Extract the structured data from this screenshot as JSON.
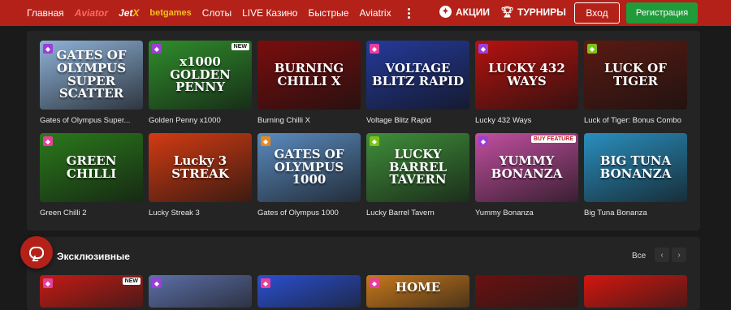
{
  "header": {
    "nav": [
      "Главная",
      "Aviator",
      "Jet",
      "X",
      "betgames",
      "Слоты",
      "LIVE Казино",
      "Быстрые",
      "Aviatrix"
    ],
    "promo_label": "АКЦИИ",
    "tournaments_label": "ТУРНИРЫ",
    "login_label": "Вход",
    "register_label": "Регистрация"
  },
  "games": [
    {
      "name": "Gates of Olympus Super...",
      "art": "GATES OF OLYMPUS SUPER SCATTER",
      "bg": "#8fb3d9"
    },
    {
      "name": "Golden Penny x1000",
      "art": "x1000 GOLDEN PENNY",
      "bg": "#2f8e2c",
      "tag": "NEW"
    },
    {
      "name": "Burning Chilli X",
      "art": "BURNING CHILLI X",
      "bg": "#7a0d0d"
    },
    {
      "name": "Voltage Blitz Rapid",
      "art": "VOLTAGE BLITZ RAPID",
      "bg": "#243a9a"
    },
    {
      "name": "Lucky 432 Ways",
      "art": "LUCKY 432 WAYS",
      "bg": "#b5120f"
    },
    {
      "name": "Luck of Tiger: Bonus Combo",
      "art": "LUCK OF TIGER",
      "bg": "#5a1a12"
    },
    {
      "name": "Green Chilli 2",
      "art": "GREEN CHILLI",
      "bg": "#2a7a1b"
    },
    {
      "name": "Lucky Streak 3",
      "art": "Lucky 3 STREAK",
      "bg": "#d23b12"
    },
    {
      "name": "Gates of Olympus 1000",
      "art": "GATES OF OLYMPUS 1000",
      "bg": "#5b8bbf"
    },
    {
      "name": "Lucky Barrel Tavern",
      "art": "LUCKY BARREL TAVERN",
      "bg": "#3f8f3a"
    },
    {
      "name": "Yummy Bonanza",
      "art": "YUMMY BONANZA",
      "bg": "#c24fa0",
      "tag": "BUY FEATURE"
    },
    {
      "name": "Big Tuna Bonanza",
      "art": "BIG TUNA BONANZA",
      "bg": "#2a8fbf"
    }
  ],
  "exclusive": {
    "title": "Эксклюзивные",
    "all_label": "Все",
    "prev_icon": "‹",
    "next_icon": "›",
    "tiles": [
      {
        "bg": "#c51a14",
        "tag": "NEW"
      },
      {
        "bg": "#5c6fa8"
      },
      {
        "bg": "#2a4fd0"
      },
      {
        "bg": "#c8781a",
        "art": "HOME"
      },
      {
        "bg": "#6a1010"
      },
      {
        "bg": "#d4160f"
      }
    ]
  },
  "colors": {
    "header": "#b32119",
    "register": "#1f9b3a"
  }
}
